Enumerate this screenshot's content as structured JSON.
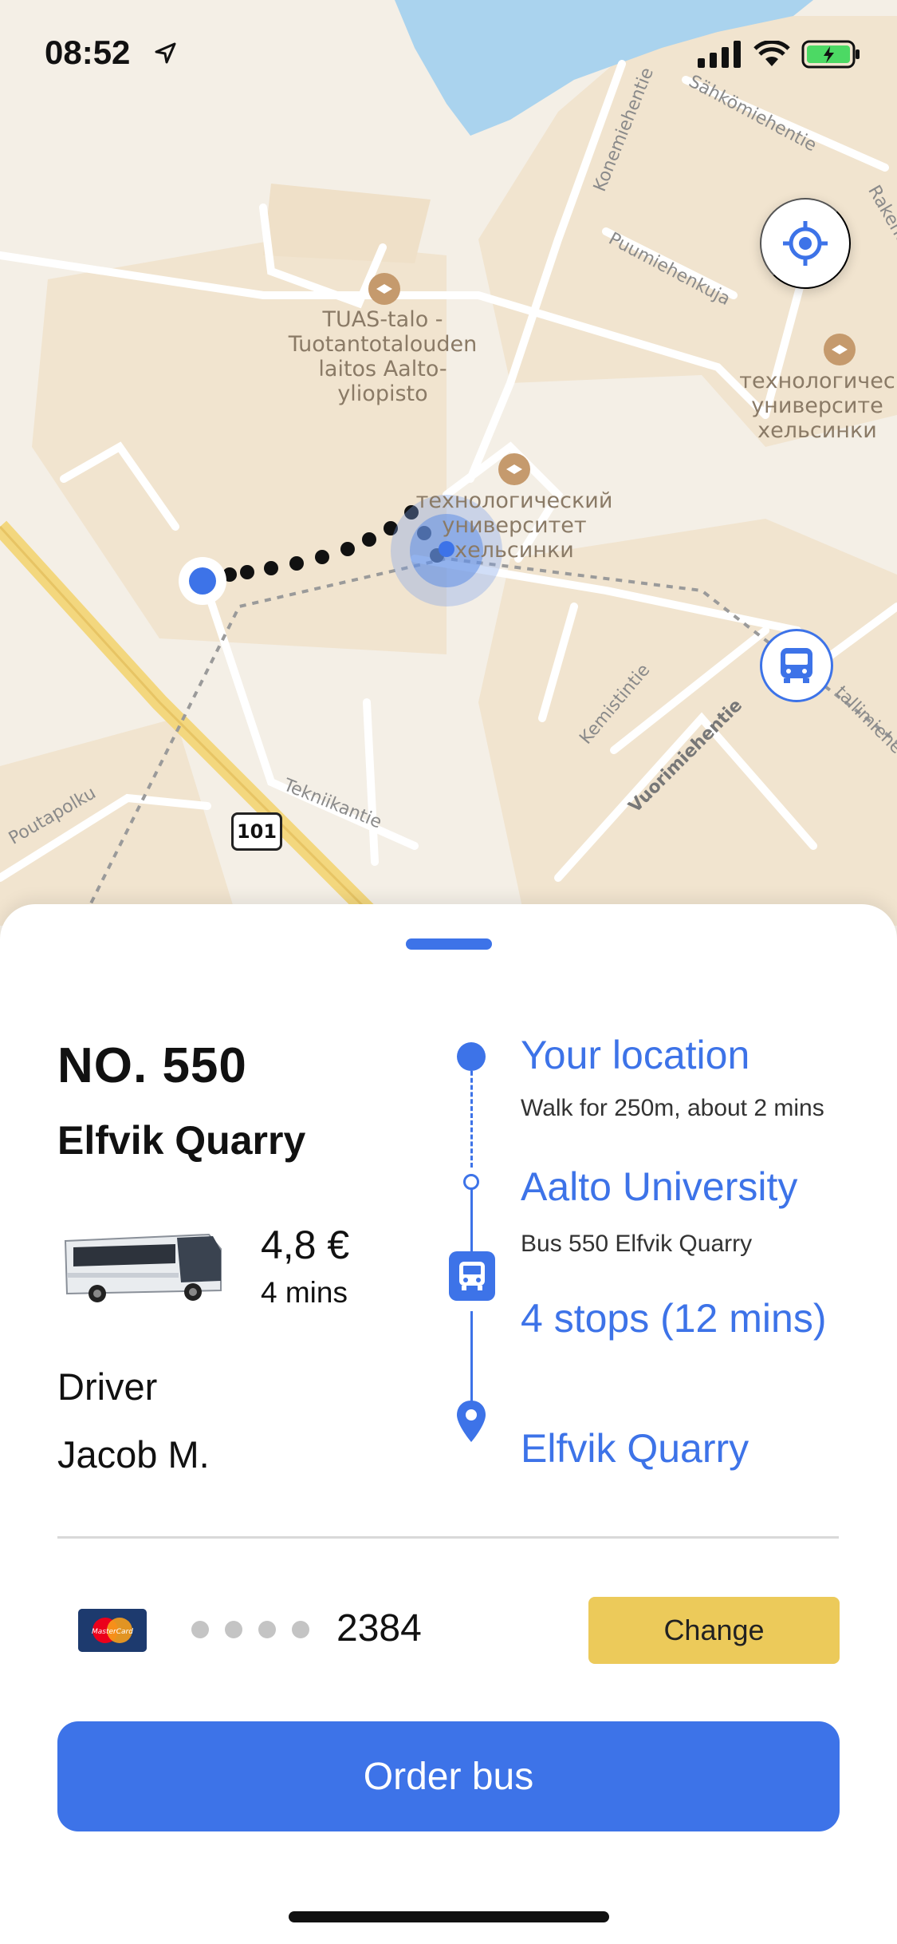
{
  "status_bar": {
    "time": "08:52",
    "icons": [
      "location-arrow-icon",
      "signal-icon",
      "wifi-icon",
      "battery-charging-icon"
    ]
  },
  "map": {
    "places": [
      {
        "name": "TUAS-talo - Tuotantotalouden laitos Aalto-yliopisto",
        "lines": [
          "TUAS-talo -",
          "Tuotantotalouden",
          "laitos Aalto-",
          "yliopisto"
        ]
      },
      {
        "name": "технологический университет хельсинки (center)",
        "lines": [
          "технологический",
          "университет",
          "хельсинки"
        ]
      },
      {
        "name": "технологичес университе хельсинки (right)",
        "lines": [
          "технологичес",
          "университе",
          "хельсинки"
        ]
      }
    ],
    "streets": [
      "Konemiehentie",
      "Sähkömiehentie",
      "Puumiehenkuja",
      "Rakent",
      "Kemistintie",
      "Vuorimiehentie",
      "Tekniikantie",
      "Poutapolku",
      "tallimiehe"
    ],
    "route_badge": "101",
    "colors": {
      "land": "#f4efe6",
      "block": "#f1e4cf",
      "water": "#aad3ee",
      "road": "#ffffff",
      "highway": "#f3d77e",
      "route_dots": "#111111",
      "user": "#3d73e8"
    }
  },
  "trip": {
    "route_number": "NO. 550",
    "destination": "Elfvik Quarry",
    "price": "4,8 €",
    "duration": "4 mins",
    "driver_label": "Driver",
    "driver_name": "Jacob M."
  },
  "timeline": [
    {
      "title": "Your location",
      "subtitle": "Walk for 250m, about 2 mins"
    },
    {
      "title": "Aalto University",
      "subtitle": "Bus 550 Elfvik Quarry"
    },
    {
      "title": "4 stops (12 mins)"
    },
    {
      "title": "Elfvik Quarry"
    }
  ],
  "payment": {
    "card_brand": "MasterCard",
    "masked_dots": "••••",
    "last4": "2384",
    "change_label": "Change"
  },
  "order_label": "Order bus",
  "colors": {
    "accent": "#3d73e8",
    "change_button": "#ecca5a"
  }
}
